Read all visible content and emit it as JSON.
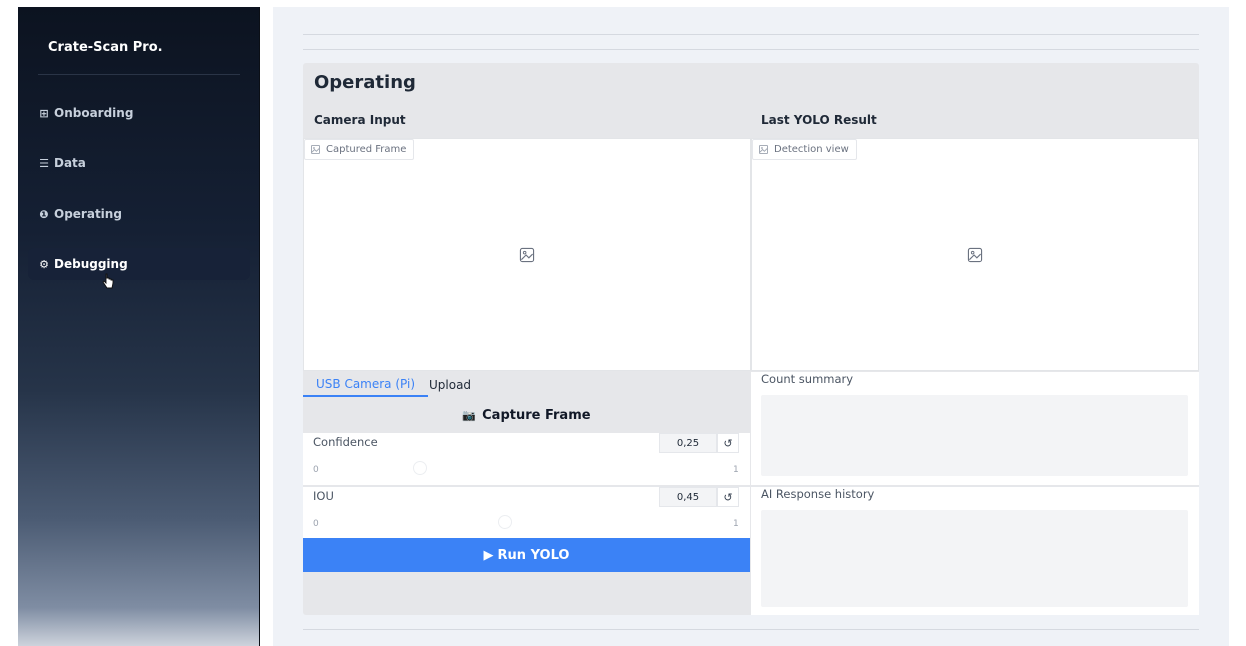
{
  "sidebar": {
    "brand": "Crate-Scan Pro.",
    "items": [
      {
        "icon": "⊞",
        "label": "Onboarding"
      },
      {
        "icon": "☰",
        "label": "Data"
      },
      {
        "icon": "❶",
        "label": "Operating"
      },
      {
        "icon": "⚙",
        "label": "Debugging"
      }
    ],
    "active_item": "Debugging"
  },
  "panel": {
    "title": "Operating",
    "left_column_title": "Camera Input",
    "right_column_title": "Last YOLO Result",
    "captured_chip": "Captured Frame",
    "detection_chip": "Detection view",
    "tabs": [
      "USB Camera (Pi)",
      "Upload"
    ],
    "active_tab": "USB Camera (Pi)",
    "capture_button": {
      "icon": "📷",
      "label": "Capture Frame"
    },
    "confidence": {
      "label": "Confidence",
      "value": "0,25",
      "min": "0",
      "max": "1",
      "fraction": 0.25
    },
    "iou": {
      "label": "IOU",
      "value": "0,45",
      "min": "0",
      "max": "1",
      "fraction": 0.45
    },
    "run_button": {
      "icon": "▶",
      "label": "Run YOLO"
    },
    "count_summary_label": "Count summary",
    "ai_history_label": "AI Response history"
  },
  "colors": {
    "accent": "#3b82f6",
    "sidebar_bg": "#0c1320",
    "panel_bg": "#e6e7ea"
  }
}
